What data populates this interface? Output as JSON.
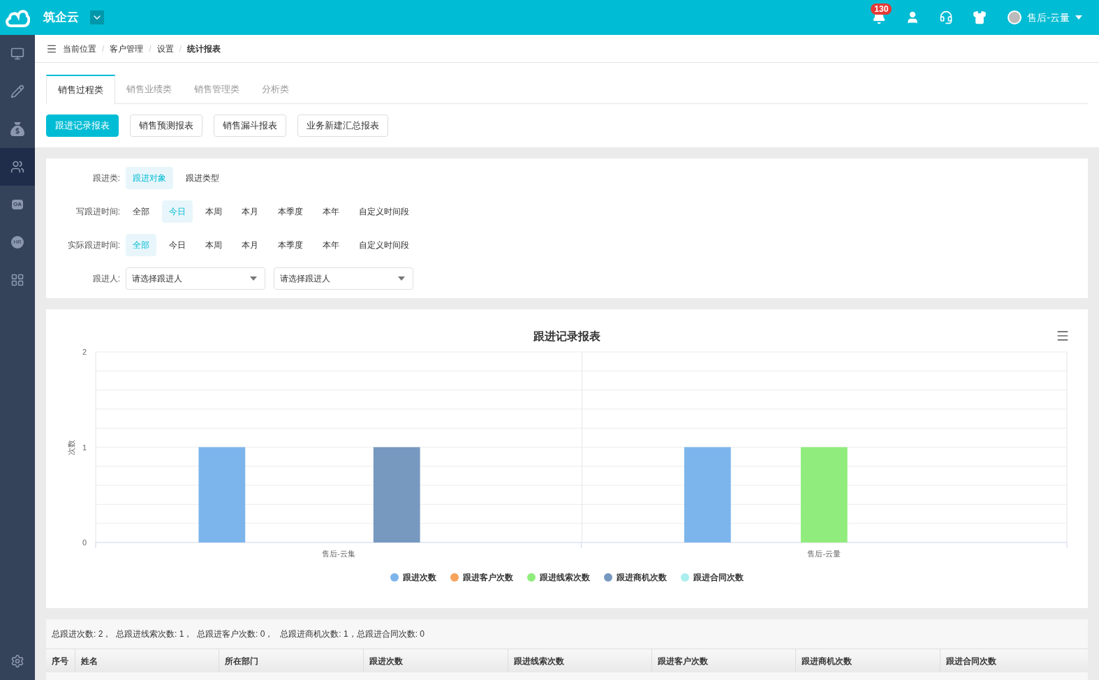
{
  "header": {
    "title": "筑企云",
    "notification_count": "130",
    "user_name": "售后-云量"
  },
  "sidebar": {
    "items": [
      {
        "kind": "monitor",
        "selected": false
      },
      {
        "kind": "pencil",
        "selected": false
      },
      {
        "kind": "moneybag",
        "selected": false
      },
      {
        "kind": "users",
        "selected": true
      },
      {
        "kind": "oa",
        "label": "OA",
        "selected": false
      },
      {
        "kind": "hr",
        "label": "HR",
        "selected": false
      },
      {
        "kind": "grid",
        "selected": false
      }
    ]
  },
  "breadcrumb": {
    "label": "当前位置",
    "separator": "/",
    "items": [
      "客户管理",
      "设置",
      "统计报表"
    ]
  },
  "tabs": [
    {
      "label": "销售过程类",
      "selected": true
    },
    {
      "label": "销售业绩类",
      "selected": false
    },
    {
      "label": "销售管理类",
      "selected": false
    },
    {
      "label": "分析类",
      "selected": false
    }
  ],
  "report_buttons": [
    {
      "label": "跟进记录报表",
      "selected": true
    },
    {
      "label": "销售预测报表",
      "selected": false
    },
    {
      "label": "销售漏斗报表",
      "selected": false
    },
    {
      "label": "业务新建汇总报表",
      "selected": false
    }
  ],
  "filters": [
    {
      "label": "跟进类:",
      "kind": "options",
      "options": [
        {
          "label": "跟进对象",
          "selected": true
        },
        {
          "label": "跟进类型",
          "selected": false
        }
      ]
    },
    {
      "label": "写跟进时间:",
      "kind": "options",
      "options": [
        {
          "label": "全部",
          "selected": false
        },
        {
          "label": "今日",
          "selected": true
        },
        {
          "label": "本周",
          "selected": false
        },
        {
          "label": "本月",
          "selected": false
        },
        {
          "label": "本季度",
          "selected": false
        },
        {
          "label": "本年",
          "selected": false
        },
        {
          "label": "自定义时间段",
          "selected": false
        }
      ]
    },
    {
      "label": "实际跟进时间:",
      "kind": "options",
      "options": [
        {
          "label": "全部",
          "selected": true
        },
        {
          "label": "今日",
          "selected": false
        },
        {
          "label": "本周",
          "selected": false
        },
        {
          "label": "本月",
          "selected": false
        },
        {
          "label": "本季度",
          "selected": false
        },
        {
          "label": "本年",
          "selected": false
        },
        {
          "label": "自定义时间段",
          "selected": false
        }
      ]
    },
    {
      "label": "跟进人:",
      "kind": "selects",
      "selects": [
        {
          "placeholder": "请选择跟进人"
        },
        {
          "placeholder": "请选择跟进人"
        }
      ]
    }
  ],
  "chart": {
    "chart_data": {
      "type": "bar",
      "title": "跟进记录报表",
      "ylabel": "次数",
      "categories": [
        "售后-云集",
        "售后-云量"
      ],
      "series": [
        {
          "name": "跟进次数",
          "color": "#7cb5ec",
          "values": [
            1,
            1
          ]
        },
        {
          "name": "跟进客户次数",
          "color": "#f7a35c",
          "values": [
            0,
            0
          ]
        },
        {
          "name": "跟进线索次数",
          "color": "#90ed7d",
          "values": [
            0,
            1
          ]
        },
        {
          "name": "跟进商机次数",
          "color": "#7798bf",
          "values": [
            1,
            0
          ]
        },
        {
          "name": "跟进合同次数",
          "color": "#aaeeee",
          "values": [
            0,
            0
          ]
        }
      ],
      "ylim": [
        0,
        2
      ],
      "yticks": [
        0,
        1,
        2
      ]
    }
  },
  "summary": "总跟进次数: 2，  总跟进线索次数: 1，  总跟进客户次数: 0，   总跟进商机次数: 1，总跟进合同次数: 0",
  "table": {
    "columns": [
      "序号",
      "姓名",
      "所在部门",
      "跟进次数",
      "跟进线索次数",
      "跟进客户次数",
      "跟进商机次数",
      "跟进合同次数"
    ]
  }
}
